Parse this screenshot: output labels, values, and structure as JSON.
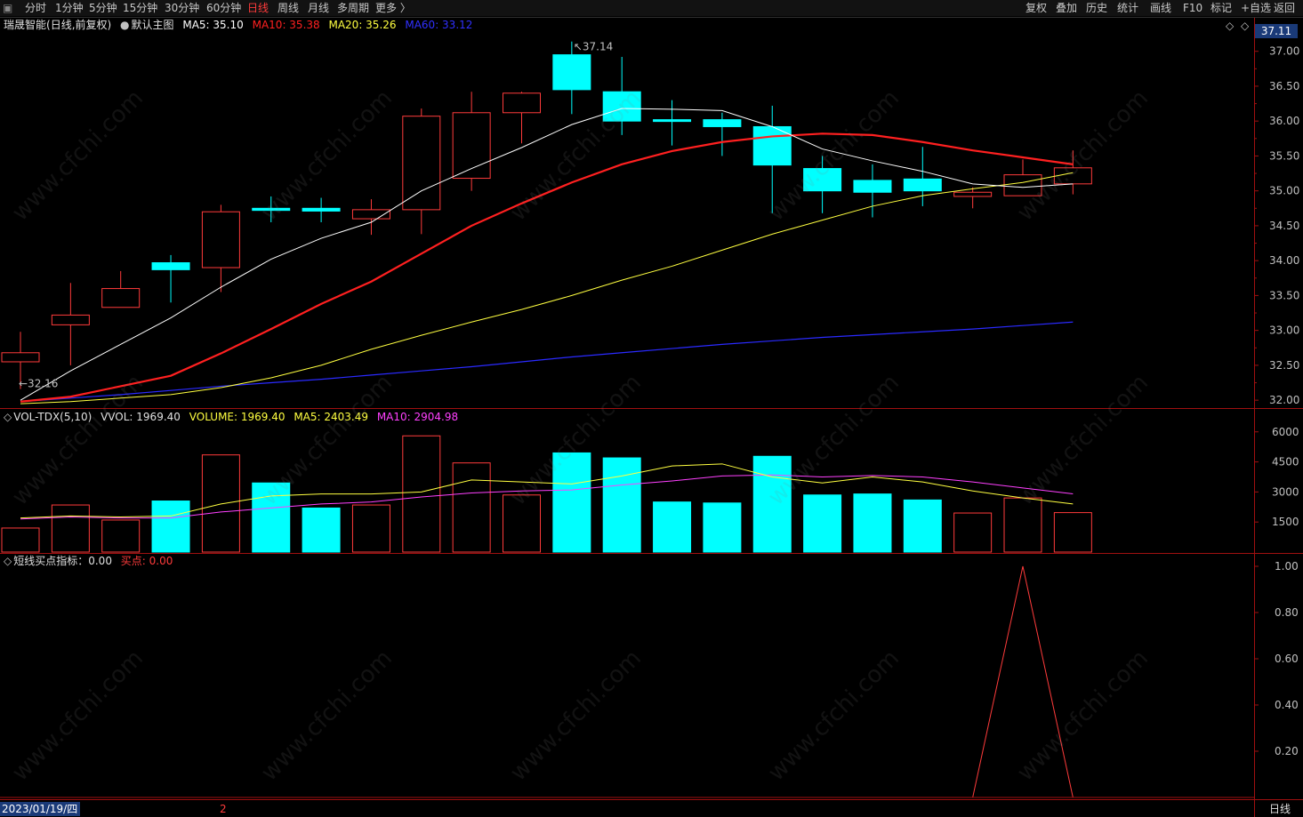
{
  "toolbar": {
    "left_items": [
      "分时",
      "1分钟",
      "5分钟",
      "15分钟",
      "30分钟",
      "60分钟",
      "日线",
      "周线",
      "月线",
      "多周期",
      "更多 〉"
    ],
    "active_index": 6,
    "right_items": [
      "复权",
      "叠加",
      "历史",
      "统计",
      "画线",
      "F10",
      "标记",
      "+自选",
      "返回"
    ]
  },
  "main_legend": {
    "stock": "瑞晟智能",
    "mode": "(日线,前复权)",
    "template": "默认主图",
    "ma5": "MA5: 35.10",
    "ma10": "MA10: 35.38",
    "ma20": "MA20: 35.26",
    "ma60": "MA60: 33.12"
  },
  "vol_legend": {
    "name": "VOL-TDX(5,10)",
    "vvol": "VVOL: 1969.40",
    "volume": "VOLUME: 1969.40",
    "ma5": "MA5: 2403.49",
    "ma10": "MA10: 2904.98"
  },
  "ind_legend": {
    "name": "短线买点指标：0.00",
    "buy": "买点: 0.00"
  },
  "current_price": "37.11",
  "date_label": "2023/01/19/四",
  "page_marker": "2",
  "period_label": "日线",
  "watermark_text": "www.cfchi.com",
  "colors": {
    "up": "#ff3b3b",
    "down": "#00ffff",
    "ma5": "#ffffff",
    "ma10": "#ff2020",
    "ma20": "#ffff40",
    "ma60": "#2a2aff",
    "vol_ma10": "#ff40ff",
    "frame": "#a01010"
  },
  "chart_data": [
    {
      "type": "candlestick",
      "title": "",
      "ylim": [
        31.9,
        37.2
      ],
      "y_ticks": [
        "37.00",
        "36.50",
        "36.00",
        "35.50",
        "35.00",
        "34.50",
        "34.00",
        "33.50",
        "33.00",
        "32.50",
        "32.00"
      ],
      "annotations": [
        {
          "label": "37.14"
        },
        {
          "label": "32.16"
        }
      ],
      "candles": [
        {
          "o": 32.55,
          "h": 32.98,
          "l": 32.16,
          "c": 32.68
        },
        {
          "o": 33.08,
          "h": 33.68,
          "l": 32.5,
          "c": 33.22
        },
        {
          "o": 33.33,
          "h": 33.85,
          "l": 33.33,
          "c": 33.6
        },
        {
          "o": 33.97,
          "h": 34.08,
          "l": 33.4,
          "c": 33.87
        },
        {
          "o": 33.9,
          "h": 34.8,
          "l": 33.55,
          "c": 34.7
        },
        {
          "o": 34.75,
          "h": 34.92,
          "l": 34.55,
          "c": 34.72
        },
        {
          "o": 34.75,
          "h": 34.9,
          "l": 34.55,
          "c": 34.71
        },
        {
          "o": 34.6,
          "h": 34.88,
          "l": 34.37,
          "c": 34.73
        },
        {
          "o": 34.73,
          "h": 36.18,
          "l": 34.38,
          "c": 36.07
        },
        {
          "o": 35.18,
          "h": 36.42,
          "l": 35.0,
          "c": 36.12
        },
        {
          "o": 36.12,
          "h": 36.42,
          "l": 35.68,
          "c": 36.4
        },
        {
          "o": 36.95,
          "h": 37.14,
          "l": 36.1,
          "c": 36.45
        },
        {
          "o": 36.42,
          "h": 36.92,
          "l": 35.8,
          "c": 36.0
        },
        {
          "o": 36.02,
          "h": 36.3,
          "l": 35.65,
          "c": 36.0
        },
        {
          "o": 36.02,
          "h": 36.12,
          "l": 35.5,
          "c": 35.92
        },
        {
          "o": 35.92,
          "h": 36.22,
          "l": 34.68,
          "c": 35.37
        },
        {
          "o": 35.32,
          "h": 35.5,
          "l": 34.68,
          "c": 35.0
        },
        {
          "o": 35.15,
          "h": 35.38,
          "l": 34.62,
          "c": 34.98
        },
        {
          "o": 35.17,
          "h": 35.63,
          "l": 34.78,
          "c": 35.0
        },
        {
          "o": 34.92,
          "h": 35.05,
          "l": 34.75,
          "c": 34.98
        },
        {
          "o": 34.93,
          "h": 35.45,
          "l": 34.93,
          "c": 35.23
        },
        {
          "o": 35.1,
          "h": 35.58,
          "l": 34.95,
          "c": 35.33
        }
      ],
      "ma5": [
        32.0,
        32.42,
        32.8,
        33.18,
        33.62,
        34.02,
        34.32,
        34.55,
        35.0,
        35.32,
        35.62,
        35.95,
        36.18,
        36.17,
        36.15,
        35.92,
        35.6,
        35.43,
        35.28,
        35.1,
        35.05,
        35.1
      ],
      "ma10": [
        31.98,
        32.05,
        32.2,
        32.35,
        32.67,
        33.02,
        33.38,
        33.7,
        34.1,
        34.5,
        34.82,
        35.12,
        35.38,
        35.57,
        35.7,
        35.78,
        35.82,
        35.8,
        35.7,
        35.58,
        35.48,
        35.38
      ],
      "ma20": [
        31.95,
        31.98,
        32.03,
        32.08,
        32.18,
        32.32,
        32.5,
        32.73,
        32.93,
        33.12,
        33.3,
        33.5,
        33.72,
        33.92,
        34.15,
        34.38,
        34.58,
        34.78,
        34.93,
        35.03,
        35.12,
        35.26
      ],
      "ma60": [
        31.98,
        32.03,
        32.08,
        32.14,
        32.2,
        32.25,
        32.3,
        32.36,
        32.42,
        32.48,
        32.55,
        32.62,
        32.68,
        32.74,
        32.8,
        32.85,
        32.9,
        32.94,
        32.98,
        33.02,
        33.07,
        33.12
      ]
    },
    {
      "type": "bar",
      "title": "VOL-TDX(5,10)",
      "ylim": [
        0,
        6300
      ],
      "y_ticks": [
        "6000",
        "4500",
        "3000",
        "1500"
      ],
      "values": [
        1200,
        2350,
        1600,
        2550,
        4850,
        3450,
        2200,
        2350,
        5800,
        4450,
        2850,
        4950,
        4700,
        2500,
        2450,
        4780,
        2850,
        2900,
        2600,
        1950,
        2700,
        1969.4
      ],
      "up": [
        true,
        true,
        true,
        false,
        true,
        false,
        false,
        true,
        true,
        true,
        true,
        false,
        false,
        false,
        false,
        false,
        false,
        false,
        false,
        true,
        true,
        true
      ],
      "ma5": [
        1700,
        1800,
        1750,
        1800,
        2400,
        2800,
        2900,
        2900,
        3000,
        3600,
        3500,
        3400,
        3800,
        4300,
        4400,
        3750,
        3450,
        3750,
        3500,
        3050,
        2700,
        2403.49
      ],
      "ma10": [
        1650,
        1750,
        1700,
        1700,
        2000,
        2200,
        2400,
        2500,
        2750,
        2950,
        3050,
        3100,
        3350,
        3550,
        3800,
        3850,
        3750,
        3820,
        3750,
        3500,
        3200,
        2904.98
      ]
    },
    {
      "type": "line",
      "title": "短线买点指标",
      "ylim": [
        0,
        1.05
      ],
      "y_ticks": [
        "1.00",
        "0.80",
        "0.60",
        "0.40",
        "0.20"
      ],
      "values": [
        0,
        0,
        0,
        0,
        0,
        0,
        0,
        0,
        0,
        0,
        0,
        0,
        0,
        0,
        0,
        0,
        0,
        0,
        0,
        0,
        1,
        0
      ]
    }
  ]
}
